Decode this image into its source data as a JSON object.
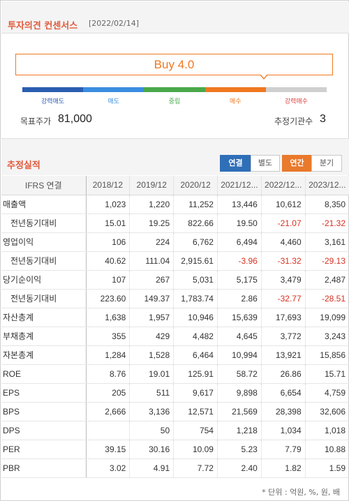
{
  "consensus": {
    "title": "투자의견 컨센서스",
    "date": "[2022/02/14]",
    "rating_label": "Buy 4.0",
    "rating_value": 4.0,
    "scale": [
      {
        "label": "강력매도",
        "color": "#2a5db0"
      },
      {
        "label": "매도",
        "color": "#3b8de0"
      },
      {
        "label": "중립",
        "color": "#4aa84a"
      },
      {
        "label": "매수",
        "color": "#f07820"
      },
      {
        "label": "강력매수",
        "color": "#cfcfcf",
        "label_color": "#e04040"
      }
    ],
    "target_price_label": "목표주가",
    "target_price_value": "81,000",
    "institutions_label": "추정기관수",
    "institutions_value": "3"
  },
  "estimates": {
    "title": "추정실적",
    "buttons": {
      "consolidated": "연결",
      "separate": "별도",
      "annual": "연간",
      "quarterly": "분기"
    },
    "header": [
      "IFRS 연결",
      "2018/12",
      "2019/12",
      "2020/12",
      "2021/12...",
      "2022/12...",
      "2023/12..."
    ],
    "rows": [
      {
        "label": "매출액",
        "sub": false,
        "values": [
          "1,023",
          "1,220",
          "11,252",
          "13,446",
          "10,612",
          "8,350"
        ]
      },
      {
        "label": "전년동기대비",
        "sub": true,
        "values": [
          "15.01",
          "19.25",
          "822.66",
          "19.50",
          "-21.07",
          "-21.32"
        ]
      },
      {
        "label": "영업이익",
        "sub": false,
        "values": [
          "106",
          "224",
          "6,762",
          "6,494",
          "4,460",
          "3,161"
        ]
      },
      {
        "label": "전년동기대비",
        "sub": true,
        "values": [
          "40.62",
          "111.04",
          "2,915.61",
          "-3.96",
          "-31.32",
          "-29.13"
        ]
      },
      {
        "label": "당기순이익",
        "sub": false,
        "values": [
          "107",
          "267",
          "5,031",
          "5,175",
          "3,479",
          "2,487"
        ]
      },
      {
        "label": "전년동기대비",
        "sub": true,
        "values": [
          "223.60",
          "149.37",
          "1,783.74",
          "2.86",
          "-32.77",
          "-28.51"
        ]
      },
      {
        "label": "자산총계",
        "sub": false,
        "values": [
          "1,638",
          "1,957",
          "10,946",
          "15,639",
          "17,693",
          "19,099"
        ]
      },
      {
        "label": "부채총계",
        "sub": false,
        "values": [
          "355",
          "429",
          "4,482",
          "4,645",
          "3,772",
          "3,243"
        ]
      },
      {
        "label": "자본총계",
        "sub": false,
        "values": [
          "1,284",
          "1,528",
          "6,464",
          "10,994",
          "13,921",
          "15,856"
        ]
      },
      {
        "label": "ROE",
        "sub": false,
        "values": [
          "8.76",
          "19.01",
          "125.91",
          "58.72",
          "26.86",
          "15.71"
        ]
      },
      {
        "label": "EPS",
        "sub": false,
        "values": [
          "205",
          "511",
          "9,617",
          "9,898",
          "6,654",
          "4,759"
        ]
      },
      {
        "label": "BPS",
        "sub": false,
        "values": [
          "2,666",
          "3,136",
          "12,571",
          "21,569",
          "28,398",
          "32,606"
        ]
      },
      {
        "label": "DPS",
        "sub": false,
        "values": [
          "",
          "50",
          "754",
          "1,218",
          "1,034",
          "1,018"
        ]
      },
      {
        "label": "PER",
        "sub": false,
        "values": [
          "39.15",
          "30.16",
          "10.09",
          "5.23",
          "7.79",
          "10.88"
        ]
      },
      {
        "label": "PBR",
        "sub": false,
        "values": [
          "3.02",
          "4.91",
          "7.72",
          "2.40",
          "1.82",
          "1.59"
        ]
      }
    ],
    "footnote": "* 단위 : 억원, %, 원, 배"
  }
}
